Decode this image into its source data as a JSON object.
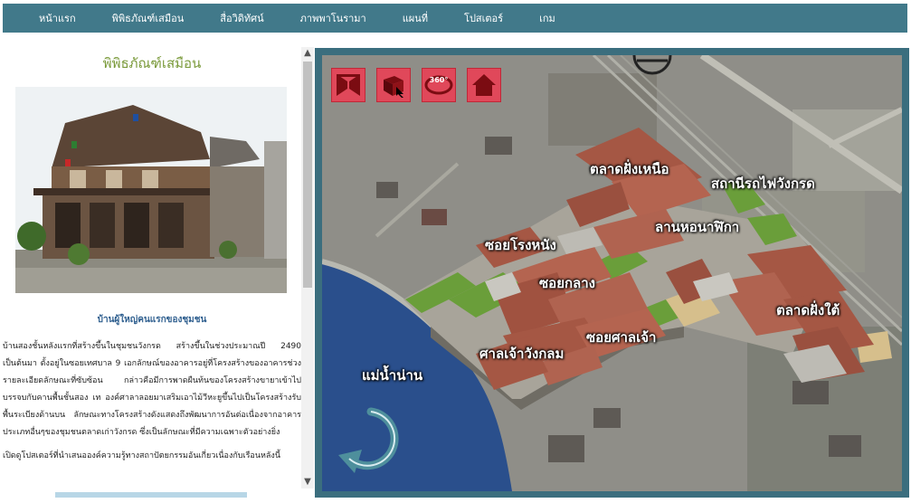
{
  "nav": {
    "items": [
      {
        "label": "หน้าแรก"
      },
      {
        "label": "พิพิธภัณฑ์เสมือน"
      },
      {
        "label": "สื่อวิดิทัศน์"
      },
      {
        "label": "ภาพพาโนรามา"
      },
      {
        "label": "แผนที่"
      },
      {
        "label": "โปสเตอร์"
      },
      {
        "label": "เกม"
      }
    ]
  },
  "left": {
    "title": "พิพิธภัณฑ์เสมือน",
    "caption": "บ้านผู้ใหญ่คนแรกของชุมชน",
    "body": "บ้านสองชั้นหลังแรกที่สร้างขึ้นในชุมชนวังกรด สร้างขึ้นในช่วงประมาณปี 2490 เป็นต้นมา ตั้งอยู่ในซอยเทศบาล 9 เอกลักษณ์ของอาคารอยู่ที่โครงสร้างของอาคารช่วงรายละเอียดลักษณะที่ซับซ้อน กล่าวคือมีการพาดผืนท้นของโครงสร้างขายาเข้าไปบรรจบกับคานพื้นชั้นสอง เท องค์ศาลาลอยมาเสริมเอาไม้วีหะยูขึ้นไปเป็นโครงสร้างรับพื้นระเบียงด้านบน ลักษณะทางโครงสร้างดังแสดงถึงพัฒนาการอันต่อเนื่องจากอาคารประเภทอื่นๆของชุมชนตลาดเก่าวังกรด ซึ่งเป็นลักษณะที่มีความเฉพาะตัวอย่างยิ่ง",
    "promo": "เปิดดูโปสเตอร์ที่นำเสนอองค์ความรู้ทางสถาปัตยกรรมอันเกี่ยวเนื่องกับเรือนหลังนี้"
  },
  "map": {
    "labels": {
      "north_market": "ตลาดฝั่งเหนือ",
      "station": "สถานีรถไฟวังกรด",
      "clock_yard": "ลานหอนาฬิกา",
      "soi_mill": "ซอยโรงหนัง",
      "soi_middle": "ซอยกลาง",
      "south_market": "ตลาดฝั่งใต้",
      "soi_shrine": "ซอยศาลเจ้า",
      "shrine": "ศาลเจ้าวังกลม",
      "river": "แม่น้ำน่าน"
    },
    "tools": [
      "fullscreen-icon",
      "3d-box-icon",
      "panorama-360-icon",
      "home-icon"
    ],
    "tool_360_text": "360°"
  },
  "colors": {
    "nav_bg": "#41798a",
    "frame": "#3b6e7e",
    "tool_btn": "#e0485a",
    "title": "#7a9a3a",
    "caption": "#2f5f8f"
  }
}
